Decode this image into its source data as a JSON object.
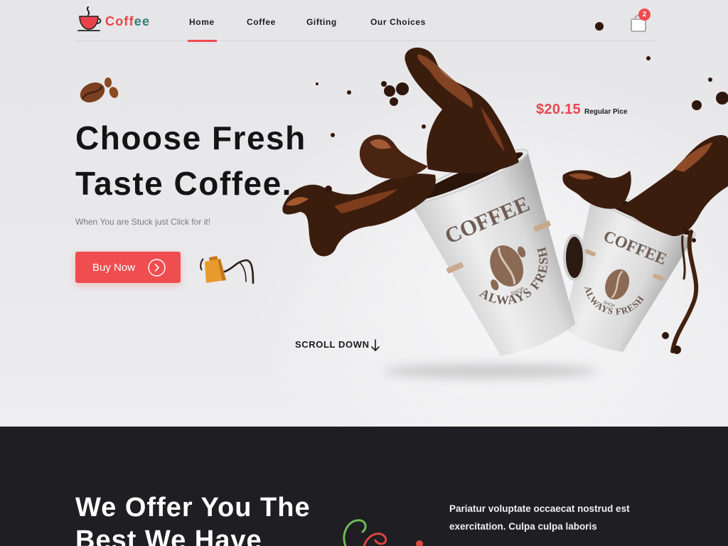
{
  "brand": {
    "name_primary": "Coff",
    "name_accent": "ee",
    "icon": "coffee-cup-logo-icon"
  },
  "nav": {
    "items": [
      {
        "label": "Home",
        "active": true
      },
      {
        "label": "Coffee",
        "active": false
      },
      {
        "label": "Gifting",
        "active": false
      },
      {
        "label": "Our Choices",
        "active": false
      }
    ],
    "cart": {
      "icon": "shopping-bag-icon",
      "badge": "2"
    }
  },
  "hero": {
    "title_lines": [
      "Choose Fresh",
      "Taste Coffee."
    ],
    "subtitle": "When You are Stuck just Click for it!",
    "cta_label": "Buy Now",
    "price": "$20.15",
    "price_note": "Regular Pice",
    "scroll_label": "SCROLL DOWN",
    "cup_labels": {
      "brand": "COFFEE",
      "slogan": "ALWAYS FRESH",
      "shop": "SHOP"
    }
  },
  "offer": {
    "title_lines": [
      "We Offer You The",
      "Best We Have"
    ],
    "text": "Pariatur voluptate occaecat nostrud est exercitation. Culpa culpa laboris"
  },
  "icons": {
    "logo": "coffee-cup-logo-icon",
    "cart": "shopping-bag-icon",
    "beans": "coffee-beans-icon",
    "kettle": "pour-over-kettle-icon",
    "cta": "arrow-circle-right-icon",
    "scroll": "arrow-down-icon"
  },
  "colors": {
    "accent": "#ef4b4f",
    "brand_accent": "#2f7c78",
    "text_dark": "#141414",
    "dark_section": "#1f1e22",
    "coffee": "#3b1d0e"
  }
}
